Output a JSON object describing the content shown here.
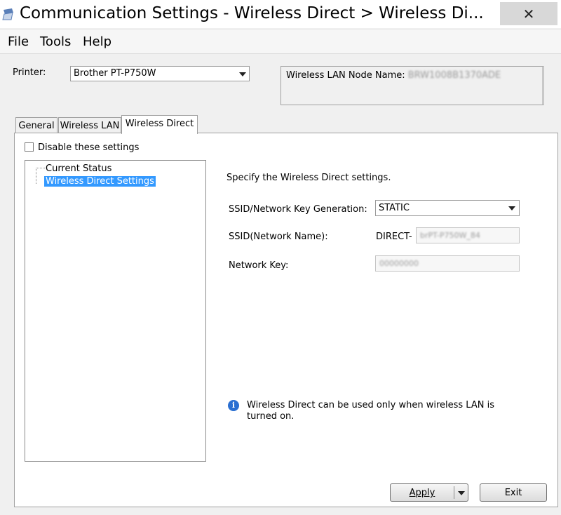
{
  "window": {
    "title": "Communication Settings - Wireless Direct > Wireless Di...",
    "close_glyph": "✕"
  },
  "menu": {
    "items": [
      "File",
      "Tools",
      "Help"
    ]
  },
  "printer": {
    "label": "Printer:",
    "selected": "Brother PT-P750W"
  },
  "node": {
    "label": "Wireless LAN Node Name: ",
    "value": "BRW1008B1370ADE"
  },
  "tabs": [
    {
      "label": "General",
      "active": false
    },
    {
      "label": "Wireless LAN",
      "active": false
    },
    {
      "label": "Wireless Direct",
      "active": true
    }
  ],
  "disable_settings": {
    "label": "Disable these settings",
    "checked": false
  },
  "tree": {
    "items": [
      {
        "label": "Current Status",
        "selected": false
      },
      {
        "label": "Wireless Direct Settings",
        "selected": true
      }
    ]
  },
  "form": {
    "instruction": "Specify the Wireless Direct settings.",
    "ssid_generation": {
      "label": "SSID/Network Key Generation:",
      "value": "STATIC"
    },
    "ssid_name": {
      "label": "SSID(Network Name):",
      "prefix": "DIRECT-",
      "value": "brPT-P750W_84"
    },
    "network_key": {
      "label": "Network Key:",
      "value": "00000000"
    }
  },
  "info": {
    "icon": "info-icon",
    "glyph": "i",
    "text": "Wireless Direct can be used only when wireless LAN is turned on."
  },
  "buttons": {
    "apply": "Apply",
    "exit": "Exit"
  },
  "colors": {
    "selection": "#3399ff",
    "info_icon": "#2a6fd1"
  }
}
